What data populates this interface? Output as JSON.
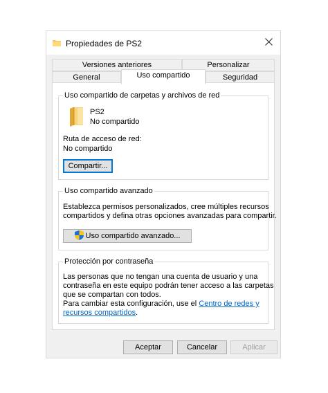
{
  "window": {
    "title": "Propiedades de PS2"
  },
  "tabs": {
    "row_back": [
      "Versiones anteriores",
      "Personalizar"
    ],
    "row_front": [
      "General",
      "Uso compartido",
      "Seguridad"
    ],
    "active": "Uso compartido"
  },
  "network_sharing": {
    "title": "Uso compartido de carpetas y archivos de red",
    "folder_name": "PS2",
    "folder_status": "No compartido",
    "path_label": "Ruta de acceso de red:",
    "path_value": "No compartido",
    "share_button": "Compartir..."
  },
  "advanced_sharing": {
    "title": "Uso compartido avanzado",
    "desc_line1": "Establezca permisos personalizados, cree múltiples recursos",
    "desc_line2": "compartidos y defina otras opciones avanzadas para compartir.",
    "button": "Uso compartido avanzado..."
  },
  "password_protection": {
    "title": "Protección por contraseña",
    "line1": "Las personas que no tengan una cuenta de usuario y una",
    "line2": "contraseña en este equipo podrán tener acceso a las carpetas",
    "line3": "que se compartan con todos.",
    "line4_prefix": "Para cambiar esta configuración, use el ",
    "link_part1": "Centro de redes y",
    "link_part2": "recursos compartidos",
    "suffix": "."
  },
  "buttons": {
    "ok": "Aceptar",
    "cancel": "Cancelar",
    "apply": "Aplicar"
  },
  "icons": {
    "title": "folder-icon",
    "folder": "folder-icon",
    "shield": "uac-shield-icon",
    "close": "close-icon"
  },
  "colors": {
    "link": "#0066cc",
    "focus": "#0078d7",
    "folder": "#f2c55c"
  }
}
